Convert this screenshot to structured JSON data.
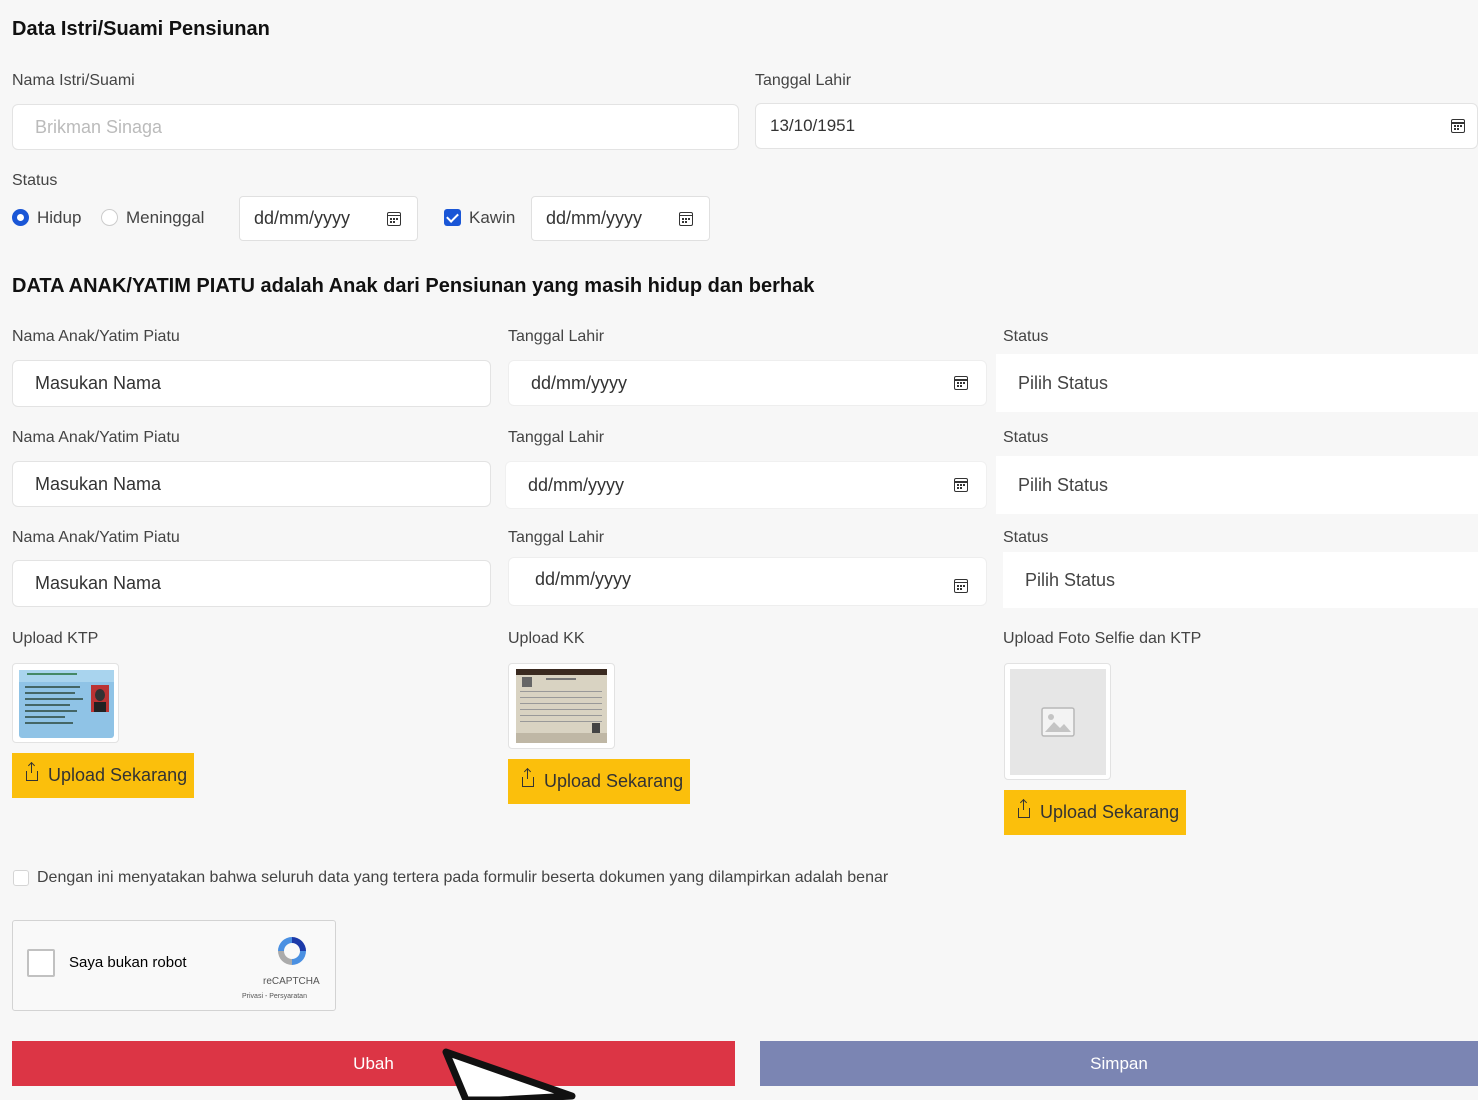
{
  "spouse": {
    "heading": "Data Istri/Suami Pensiunan",
    "name_label": "Nama Istri/Suami",
    "name_value": "Brikman Sinaga",
    "dob_label": "Tanggal Lahir",
    "dob_value": "13/10/1951",
    "status_label": "Status",
    "radio_alive": "Hidup",
    "radio_deceased": "Meninggal",
    "death_date_placeholder": "dd/mm/yyyy",
    "married_label": "Kawin",
    "married_date_placeholder": "dd/mm/yyyy"
  },
  "children": {
    "heading": "DATA ANAK/YATIM PIATU adalah Anak dari Pensiunan yang masih hidup dan berhak",
    "rows": [
      {
        "name_label": "Nama Anak/Yatim Piatu",
        "name_placeholder": "Masukan Nama",
        "dob_label": "Tanggal Lahir",
        "dob_placeholder": "dd/mm/yyyy",
        "status_label": "Status",
        "status_value": "Pilih Status"
      },
      {
        "name_label": "Nama Anak/Yatim Piatu",
        "name_placeholder": "Masukan Nama",
        "dob_label": "Tanggal Lahir",
        "dob_placeholder": "dd/mm/yyyy",
        "status_label": "Status",
        "status_value": "Pilih Status"
      },
      {
        "name_label": "Nama Anak/Yatim Piatu",
        "name_placeholder": "Masukan Nama",
        "dob_label": "Tanggal Lahir",
        "dob_placeholder": "dd/mm/yyyy",
        "status_label": "Status",
        "status_value": "Pilih Status"
      }
    ]
  },
  "uploads": {
    "ktp_label": "Upload KTP",
    "kk_label": "Upload KK",
    "selfie_label": "Upload Foto Selfie dan KTP",
    "button_label": "Upload Sekarang"
  },
  "agreement": "Dengan ini menyatakan bahwa seluruh data yang tertera pada formulir beserta dokumen yang dilampirkan adalah benar",
  "captcha": {
    "label": "Saya bukan robot",
    "brand": "reCAPTCHA",
    "links": "Privasi - Persyaratan"
  },
  "actions": {
    "edit": "Ubah",
    "save": "Simpan"
  },
  "colors": {
    "primary": "#1a56d6",
    "upload": "#fbbf0c",
    "edit": "#dc3545",
    "save": "#7b85b3"
  }
}
